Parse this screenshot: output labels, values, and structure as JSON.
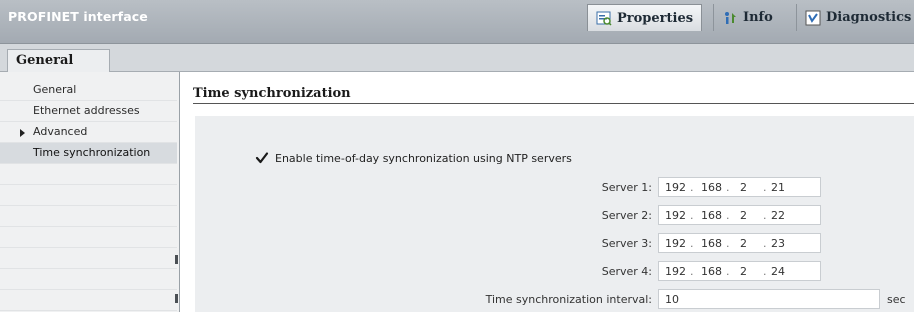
{
  "window": {
    "title": "PROFINET interface"
  },
  "inspector_tabs": [
    {
      "label": "Properties",
      "icon": "properties-icon",
      "active": true
    },
    {
      "label": "Info",
      "icon": "info-icon",
      "active": false
    },
    {
      "label": "Diagnostics",
      "icon": "diagnostics-icon",
      "active": false
    }
  ],
  "general_tab": {
    "label": "General"
  },
  "nav": {
    "items": [
      {
        "label": "General",
        "expandable": false,
        "selected": false
      },
      {
        "label": "Ethernet addresses",
        "expandable": false,
        "selected": false
      },
      {
        "label": "Advanced",
        "expandable": true,
        "selected": false
      },
      {
        "label": "Time synchronization",
        "expandable": false,
        "selected": true
      }
    ]
  },
  "section": {
    "title": "Time synchronization"
  },
  "ntp": {
    "enable_label": "Enable time-of-day synchronization using NTP servers",
    "enabled": true,
    "servers": [
      {
        "label": "Server 1:",
        "octets": [
          "192",
          "168",
          "2",
          "21"
        ]
      },
      {
        "label": "Server 2:",
        "octets": [
          "192",
          "168",
          "2",
          "22"
        ]
      },
      {
        "label": "Server 3:",
        "octets": [
          "192",
          "168",
          "2",
          "23"
        ]
      },
      {
        "label": "Server 4:",
        "octets": [
          "192",
          "168",
          "2",
          "24"
        ]
      }
    ],
    "interval_label": "Time synchronization interval:",
    "interval_value": "10",
    "interval_unit": "sec"
  },
  "colors": {
    "titlebar": "#a3aab2",
    "checkmark": "#1a1a1a",
    "panel_bg": "#eceef0"
  }
}
